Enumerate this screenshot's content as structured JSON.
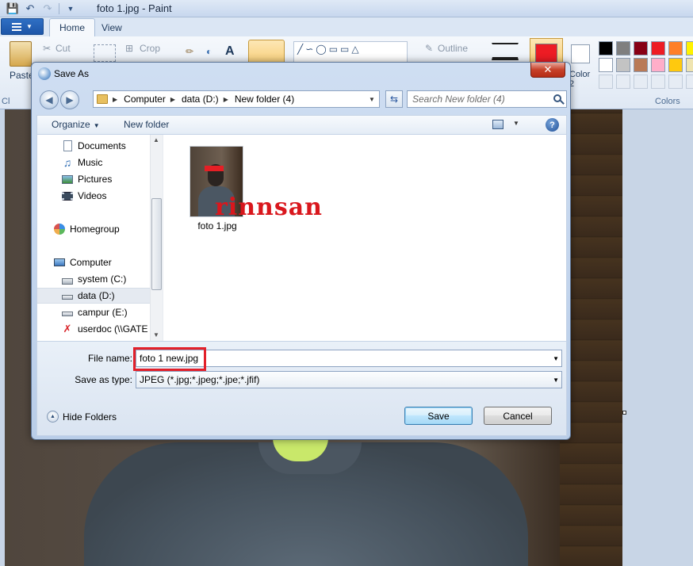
{
  "app": {
    "window_title": "foto 1.jpg - Paint",
    "tabs": [
      "Home",
      "View"
    ],
    "ribbon": {
      "paste_label": "Paste",
      "cut_label": "Cut",
      "crop_label": "Crop",
      "outline_label": "Outline",
      "color2_label": "Color 2",
      "colors_group_label": "Colors",
      "clipboard_group_partial": "Cl"
    },
    "palette": {
      "row1": [
        "#000000",
        "#7f7f7f",
        "#880015",
        "#ed1c24",
        "#ff7f27",
        "#fff200"
      ],
      "row2": [
        "#ffffff",
        "#c3c3c3",
        "#b97a57",
        "#ffaec9",
        "#ffc90e",
        "#efe4b0"
      ],
      "color1": "#ed1c24",
      "color2": "#ffffff"
    }
  },
  "dialog": {
    "title": "Save As",
    "address": {
      "crumbs": [
        "Computer",
        "data (D:)",
        "New folder (4)"
      ]
    },
    "search": {
      "placeholder": "Search New folder (4)"
    },
    "toolbar": {
      "organize_label": "Organize",
      "new_folder_label": "New folder"
    },
    "nav_items": [
      {
        "label": "Documents",
        "icon": "documents-icon"
      },
      {
        "label": "Music",
        "icon": "music-icon"
      },
      {
        "label": "Pictures",
        "icon": "pictures-icon"
      },
      {
        "label": "Videos",
        "icon": "videos-icon"
      },
      {
        "label": "Homegroup",
        "icon": "homegroup-icon"
      },
      {
        "label": "Computer",
        "icon": "computer-icon"
      },
      {
        "label": "system (C:)",
        "icon": "system-drive-icon"
      },
      {
        "label": "data (D:)",
        "icon": "drive-icon",
        "selected": true
      },
      {
        "label": "campur (E:)",
        "icon": "drive-icon"
      },
      {
        "label": "userdoc (\\\\GATE",
        "icon": "network-drive-icon"
      }
    ],
    "files": [
      {
        "name": "foto 1.jpg"
      }
    ],
    "watermark_text": "rinnsan",
    "form": {
      "file_name_label": "File name:",
      "file_name_value": "foto 1 new.jpg",
      "save_type_label": "Save as type:",
      "save_type_value": "JPEG (*.jpg;*.jpeg;*.jpe;*.jfif)",
      "hide_folders_label": "Hide Folders",
      "save_label": "Save",
      "cancel_label": "Cancel",
      "highlight_color": "#e2202a"
    }
  }
}
